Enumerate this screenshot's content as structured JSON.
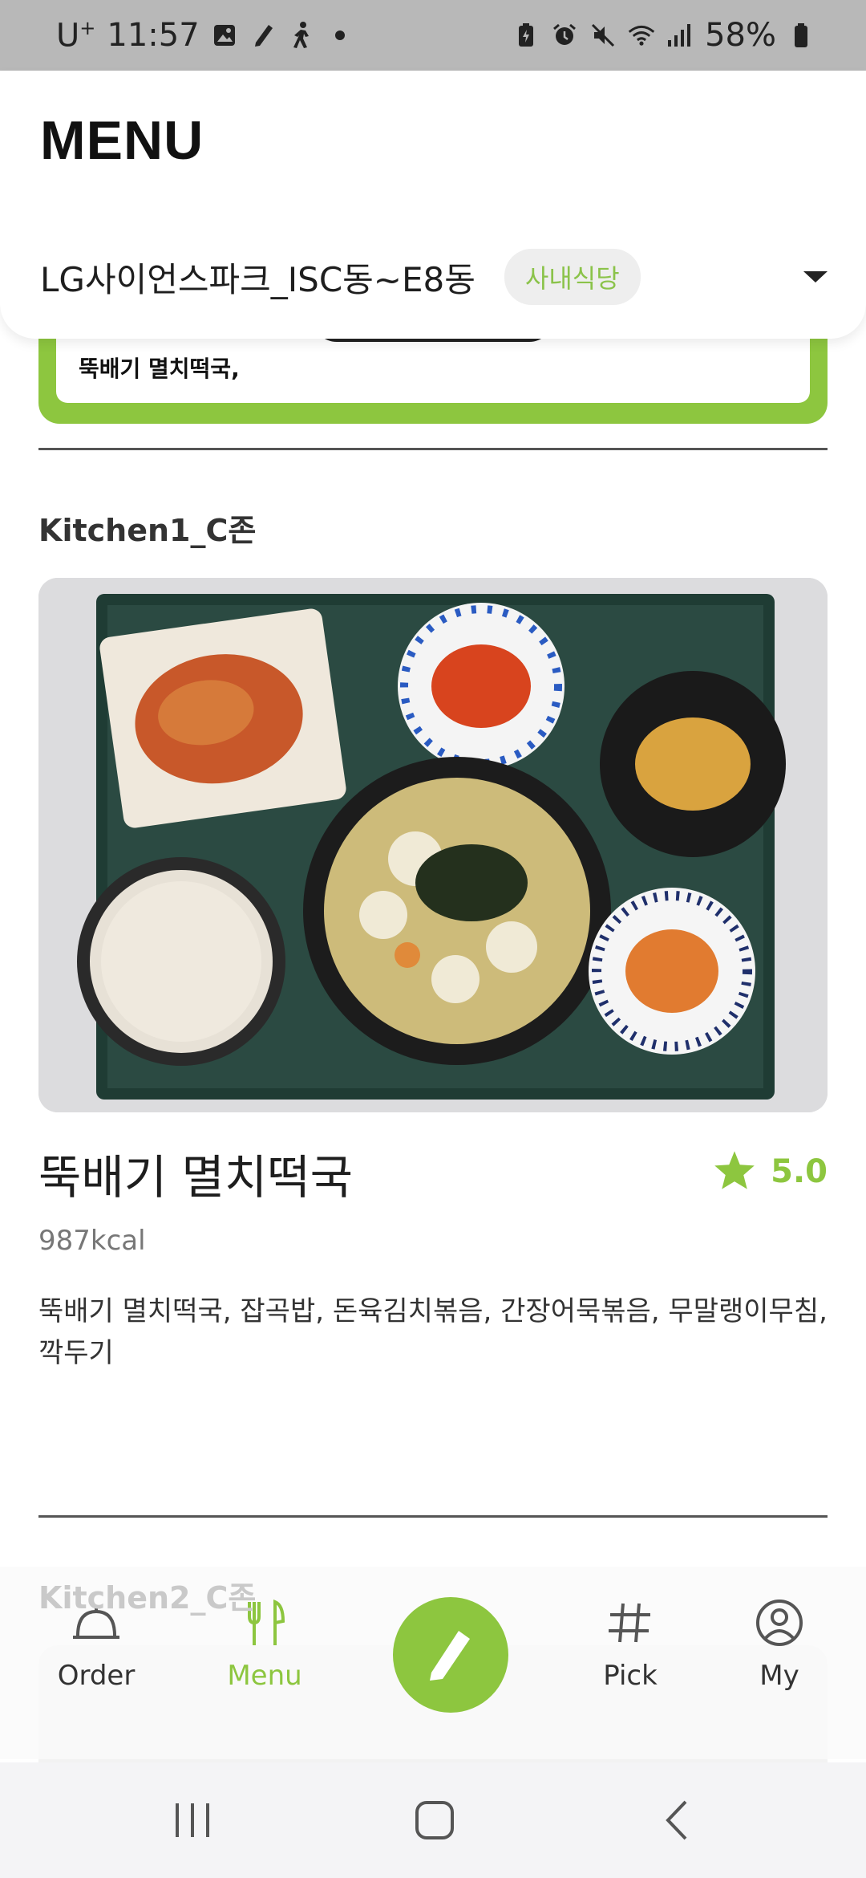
{
  "status_bar": {
    "carrier": "U",
    "carrier_sup": "+",
    "time": "11:57",
    "battery": "58%"
  },
  "header": {
    "title": "MENU",
    "location": "LG사이언스파크_ISC동~E8동",
    "badge": "사내식당"
  },
  "previous_card": {
    "text": "뚝배기 멸치떡국,"
  },
  "kitchens": [
    {
      "name": "Kitchen1_C존",
      "dish_name": "뚝배기 멸치떡국",
      "rating": "5.0",
      "kcal": "987kcal",
      "sides": "뚝배기 멸치떡국, 잡곡밥, 돈육김치볶음, 간장어묵볶음, 무말랭이무침, 깍두기"
    },
    {
      "name": "Kitchen2_C존"
    }
  ],
  "bottom_nav": {
    "items": [
      {
        "label": "Order",
        "icon": "cloche-icon"
      },
      {
        "label": "Menu",
        "icon": "fork-knife-icon"
      },
      {
        "label": "Pick",
        "icon": "hashtag-icon"
      },
      {
        "label": "My",
        "icon": "user-circle-icon"
      }
    ]
  },
  "colors": {
    "accent": "#8dc63f",
    "status_bar": "#b8b8b8"
  }
}
